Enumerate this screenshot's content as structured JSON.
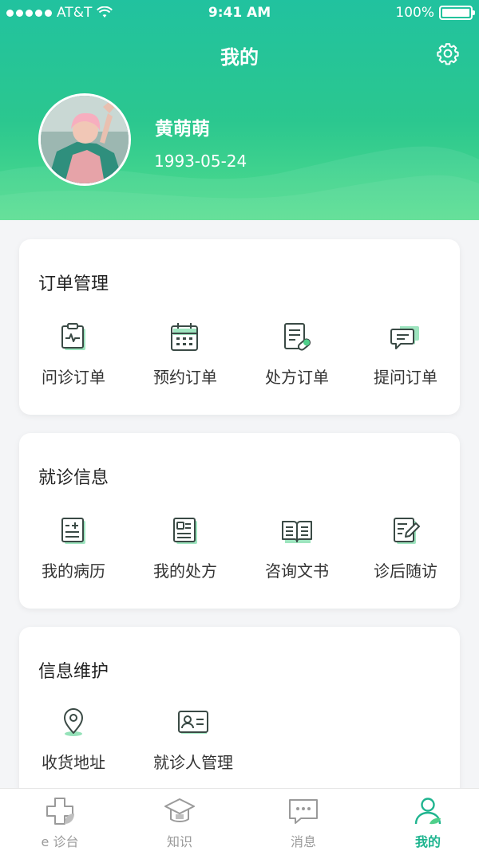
{
  "status_bar": {
    "carrier": "AT&T",
    "time": "9:41 AM",
    "battery": "100%"
  },
  "header": {
    "title": "我的",
    "settings_icon": "gear-icon"
  },
  "profile": {
    "name": "黄萌萌",
    "birthdate": "1993-05-24"
  },
  "sections": {
    "orders": {
      "title": "订单管理",
      "items": [
        {
          "label": "问诊订单",
          "icon": "clipboard-pulse-icon"
        },
        {
          "label": "预约订单",
          "icon": "calendar-icon"
        },
        {
          "label": "处方订单",
          "icon": "prescription-pill-icon"
        },
        {
          "label": "提问订单",
          "icon": "chat-bubbles-icon"
        }
      ]
    },
    "visit": {
      "title": "就诊信息",
      "items": [
        {
          "label": "我的病历",
          "icon": "medical-record-icon"
        },
        {
          "label": "我的处方",
          "icon": "prescription-doc-icon"
        },
        {
          "label": "咨询文书",
          "icon": "open-book-icon"
        },
        {
          "label": "诊后随访",
          "icon": "edit-note-icon"
        }
      ]
    },
    "info": {
      "title": "信息维护",
      "items": [
        {
          "label": "收货地址",
          "icon": "location-pin-icon"
        },
        {
          "label": "就诊人管理",
          "icon": "id-card-icon"
        }
      ]
    }
  },
  "tabbar": {
    "tabs": [
      {
        "label": "e 诊台",
        "icon": "medical-cross-icon",
        "active": false
      },
      {
        "label": "知识",
        "icon": "graduation-cap-icon",
        "active": false
      },
      {
        "label": "消息",
        "icon": "message-icon",
        "active": false
      },
      {
        "label": "我的",
        "icon": "person-icon",
        "active": true
      }
    ]
  },
  "colors": {
    "accent": "#1fb48f",
    "header_top": "#21c29f",
    "header_bottom": "#52dd8c",
    "icon_dark": "#3a4a45",
    "icon_accent": "#4fcf8a"
  }
}
